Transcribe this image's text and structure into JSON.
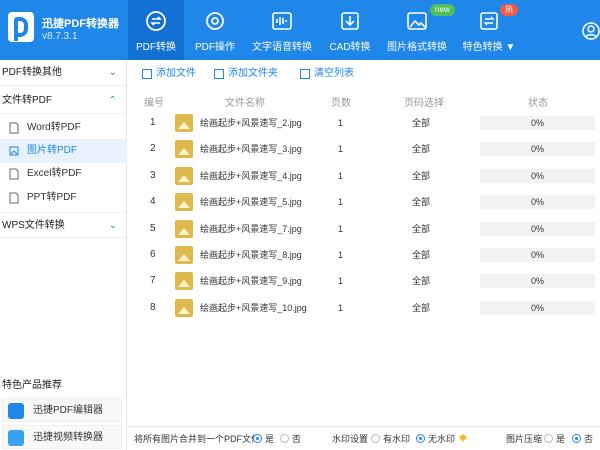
{
  "app": {
    "name": "迅捷PDF转换器",
    "version": "v8.7.3.1"
  },
  "nav": {
    "tabs": [
      {
        "label": "PDF转换",
        "icon": "pdf-convert-icon"
      },
      {
        "label": "PDF操作",
        "icon": "pdf-operate-icon"
      },
      {
        "label": "文字语音转换",
        "icon": "voice-wave-icon"
      },
      {
        "label": "CAD转换",
        "icon": "cad-icon"
      },
      {
        "label": "图片格式转换",
        "icon": "image-icon",
        "badge": "new"
      },
      {
        "label": "特色转换 ▼",
        "icon": "special-convert-icon",
        "badge": "热"
      }
    ]
  },
  "sidebar": {
    "groups": [
      {
        "label": "PDF转换其他",
        "chevron": "⌄"
      },
      {
        "label": "文件转PDF",
        "chevron": "⌃"
      },
      {
        "label": "WPS文件转换",
        "chevron": "⌄"
      }
    ],
    "items": [
      {
        "label": "Word转PDF",
        "icon": "word-doc-icon"
      },
      {
        "label": "图片转PDF",
        "icon": "image-doc-icon"
      },
      {
        "label": "Excel转PDF",
        "icon": "excel-doc-icon"
      },
      {
        "label": "PPT转PDF",
        "icon": "ppt-doc-icon"
      }
    ],
    "recommend_title": "特色产品推荐",
    "promos": [
      {
        "label": "迅捷PDF编辑器",
        "icon": "pdf-editor-icon"
      },
      {
        "label": "迅捷视频转换器",
        "icon": "video-converter-icon"
      }
    ]
  },
  "toolbar": {
    "add_file": "添加文件",
    "add_folder": "添加文件夹",
    "clear_list": "清空列表"
  },
  "table": {
    "headers": [
      "编号",
      "文件名称",
      "页数",
      "页码选择",
      "状态"
    ],
    "rows": [
      {
        "num": "1",
        "name": "绘画起步+风景速写_2.jpg",
        "pages": "1",
        "range": "全部",
        "status": "0%",
        "progress": 0
      },
      {
        "num": "2",
        "name": "绘画起步+风景速写_3.jpg",
        "pages": "1",
        "range": "全部",
        "status": "0%",
        "progress": 0
      },
      {
        "num": "3",
        "name": "绘画起步+风景速写_4.jpg",
        "pages": "1",
        "range": "全部",
        "status": "0%",
        "progress": 0
      },
      {
        "num": "4",
        "name": "绘画起步+风景速写_5.jpg",
        "pages": "1",
        "range": "全部",
        "status": "0%",
        "progress": 0
      },
      {
        "num": "5",
        "name": "绘画起步+风景速写_7.jpg",
        "pages": "1",
        "range": "全部",
        "status": "0%",
        "progress": 0
      },
      {
        "num": "6",
        "name": "绘画起步+风景速写_8.jpg",
        "pages": "1",
        "range": "全部",
        "status": "0%",
        "progress": 0
      },
      {
        "num": "7",
        "name": "绘画起步+风景速写_9.jpg",
        "pages": "1",
        "range": "全部",
        "status": "0%",
        "progress": 0
      },
      {
        "num": "8",
        "name": "绘画起步+风景速写_10.jpg",
        "pages": "1",
        "range": "全部",
        "status": "0%",
        "progress": 0
      }
    ]
  },
  "bottom": {
    "merge_label": "将所有图片合并到一个PDF文件",
    "merge_yes": "是",
    "merge_no": "否",
    "watermark_label": "水印设置",
    "watermark_on": "有水印",
    "watermark_off": "无水印",
    "compress_label": "图片压缩",
    "compress_yes": "是",
    "compress_no": "否"
  },
  "colors": {
    "primary": "#1f87ea",
    "active_tab": "#1170d2",
    "badge_new": "#4cc05a",
    "badge_hot": "#f05a4a"
  }
}
